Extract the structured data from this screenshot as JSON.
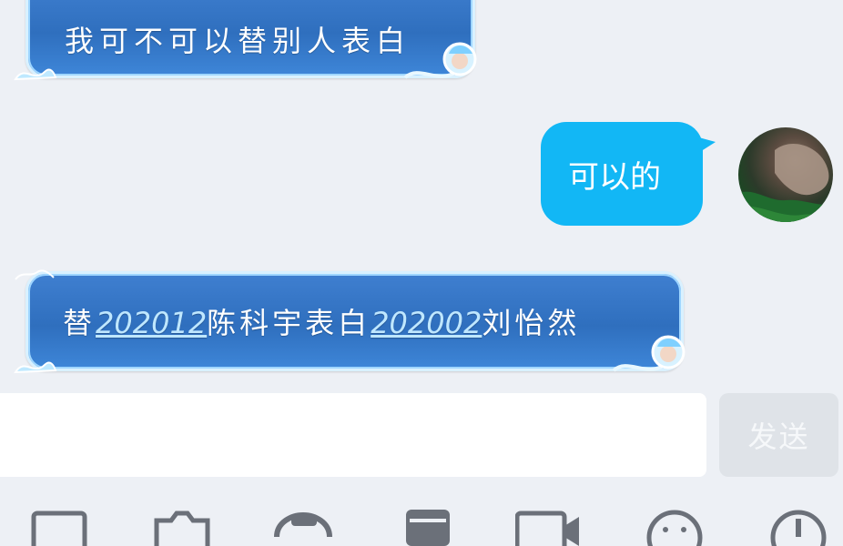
{
  "messages": [
    {
      "side": "left",
      "text": "我可不可以替别人表白"
    },
    {
      "side": "right",
      "text": "可以的"
    },
    {
      "side": "left",
      "parts": {
        "prefix": "替",
        "link1": "202012",
        "middle": "陈科宇表白",
        "link2": "202002",
        "suffix": "刘怡然"
      }
    }
  ],
  "composer": {
    "input_value": "",
    "send_label": "发送"
  },
  "toolbar": {
    "icons": [
      "image-icon",
      "camera-icon",
      "voice-icon",
      "red-packet-icon",
      "video-icon",
      "emoji-icon",
      "more-icon"
    ]
  },
  "colors": {
    "background": "#edf0f5",
    "my_bubble": "#12b7f5",
    "theme_bubble": "#2f6fbe",
    "send_disabled": "#dfe3e8",
    "toolbar_icon": "#6b7079"
  }
}
